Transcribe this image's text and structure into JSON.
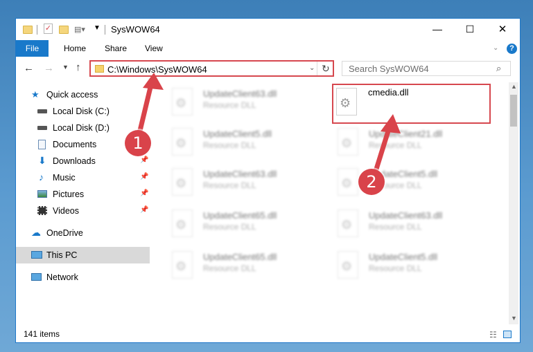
{
  "window": {
    "title": "SysWOW64",
    "minimize_glyph": "—",
    "maximize_glyph": "☐",
    "close_glyph": "✕"
  },
  "ribbon": {
    "tabs": [
      {
        "label": "File"
      },
      {
        "label": "Home"
      },
      {
        "label": "Share"
      },
      {
        "label": "View"
      }
    ],
    "help_glyph": "?"
  },
  "navbar": {
    "address": "C:\\Windows\\SysWOW64",
    "search_placeholder": "Search SysWOW64"
  },
  "sidebar": {
    "items": [
      {
        "label": "Quick access",
        "icon": "star-icon"
      },
      {
        "label": "Local Disk (C:)",
        "icon": "drive-icon"
      },
      {
        "label": "Local Disk (D:)",
        "icon": "drive-icon"
      },
      {
        "label": "Documents",
        "icon": "documents-icon"
      },
      {
        "label": "Downloads",
        "icon": "download-icon",
        "pinned": true
      },
      {
        "label": "Music",
        "icon": "music-icon",
        "pinned": true
      },
      {
        "label": "Pictures",
        "icon": "pictures-icon",
        "pinned": true
      },
      {
        "label": "Videos",
        "icon": "videos-icon",
        "pinned": true
      },
      {
        "label": "OneDrive",
        "icon": "cloud-icon"
      },
      {
        "label": "This PC",
        "icon": "computer-icon",
        "selected": true
      },
      {
        "label": "Network",
        "icon": "network-icon"
      }
    ]
  },
  "files": {
    "left_column": [
      {
        "name": "UpdateClient63.dll",
        "type": "Resource DLL"
      },
      {
        "name": "UpdateClient5.dll",
        "type": "Resource DLL"
      },
      {
        "name": "UpdateClient63.dll",
        "type": "Resource DLL"
      },
      {
        "name": "UpdateClient65.dll",
        "type": "Resource DLL"
      },
      {
        "name": "UpdateClient65.dll",
        "type": "Resource DLL"
      }
    ],
    "right_column": [
      {
        "name": "cmedia.dll",
        "type": ""
      },
      {
        "name": "UpdateClient21.dll",
        "type": "Resource DLL"
      },
      {
        "name": "UpdateClient5.dll",
        "type": "Resource DLL"
      },
      {
        "name": "UpdateClient63.dll",
        "type": "Resource DLL"
      },
      {
        "name": "UpdateClient5.dll",
        "type": "Resource DLL"
      }
    ]
  },
  "status": {
    "item_count": "141 items"
  },
  "annotations": [
    {
      "number": "1"
    },
    {
      "number": "2"
    }
  ],
  "colors": {
    "accent": "#1979ca",
    "highlight": "#d6474e"
  }
}
